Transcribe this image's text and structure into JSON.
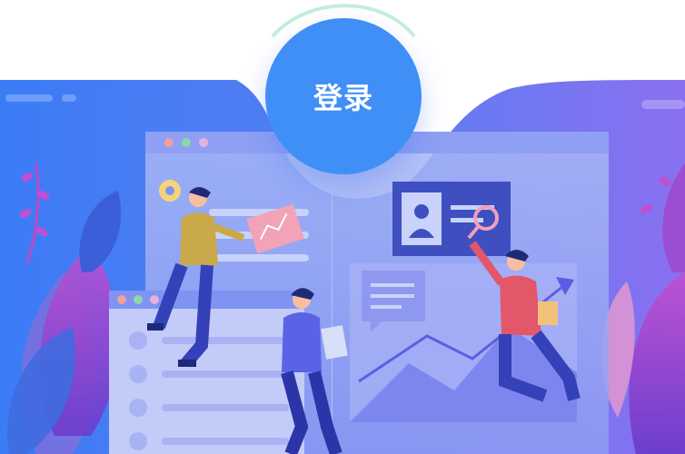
{
  "login": {
    "label": "登录"
  },
  "colors": {
    "primary": "#3f8ff6",
    "bg_left": "#3d7bf5",
    "bg_right": "#7f6ff2",
    "accent_green": "#c4eed9",
    "purple": "#a04bd3"
  },
  "illustration": {
    "windows": 3,
    "people": 3,
    "icons": [
      "id-card-icon",
      "magnifier-icon",
      "trend-arrow-icon",
      "chat-bubble-icon",
      "settings-icon"
    ]
  }
}
